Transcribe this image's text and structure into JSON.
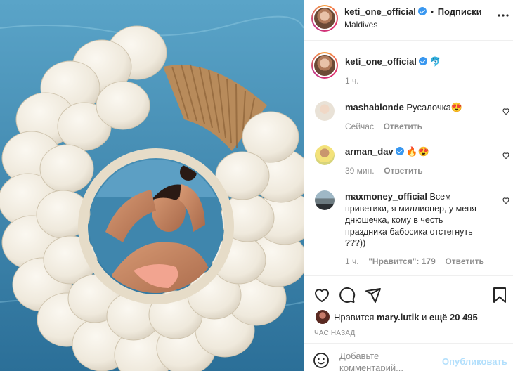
{
  "header": {
    "username": "keti_one_official",
    "separator": "•",
    "follow_label": "Подписки",
    "location": "Maldives",
    "more_icon": "more-horizontal-icon"
  },
  "caption": {
    "username": "keti_one_official",
    "emoji": "🐬",
    "time": "1 ч."
  },
  "comments": [
    {
      "username": "mashablonde",
      "text": "Русалочка😍",
      "time": "Сейчас",
      "reply_label": "Ответить"
    },
    {
      "username": "arman_dav",
      "text": "🔥😍",
      "time": "39 мин.",
      "reply_label": "Ответить"
    },
    {
      "username": "maxmoney_official",
      "text_line1": "Всем",
      "text_line2": "приветики, я миллионер, у меня",
      "text_line3": "днюшечка, кому в честь",
      "text_line4": "праздника бабосика отстегнуть",
      "text_line5": "???))",
      "time": "1 ч.",
      "likes_label": "\"Нравится\": 179",
      "reply_label": "Ответить"
    }
  ],
  "likes": {
    "prefix": "Нравится",
    "user": "mary.lutik",
    "middle": "и",
    "rest": "ещё 20 495"
  },
  "post_time": "ЧАС НАЗАД",
  "comment_box": {
    "placeholder_line1": "Добавьте",
    "placeholder_line2": "комментарий...",
    "publish_label": "Опубликовать"
  },
  "colors": {
    "accent": "#3897f0",
    "publish_disabled": "#b2dffc",
    "verified": "#3897f0"
  }
}
